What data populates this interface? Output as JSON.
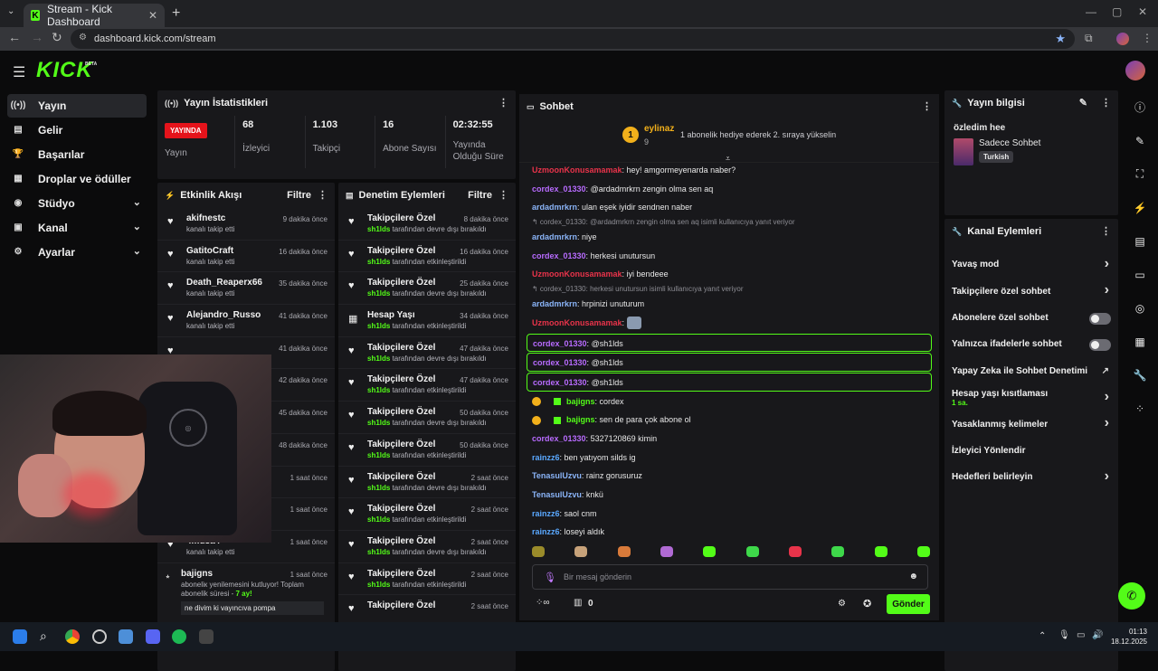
{
  "browser": {
    "tab_title": "Stream - Kick Dashboard",
    "url": "dashboard.kick.com/stream"
  },
  "app": {
    "logo": "KICK",
    "logo_tag": "BETA"
  },
  "sidebar": {
    "items": [
      {
        "label": "Yayın",
        "icon": "broadcast-icon"
      },
      {
        "label": "Gelir",
        "icon": "money-icon"
      },
      {
        "label": "Başarılar",
        "icon": "trophy-icon"
      },
      {
        "label": "Droplar ve ödüller",
        "icon": "gift-icon"
      },
      {
        "label": "Stüdyo",
        "icon": "camera-icon"
      },
      {
        "label": "Kanal",
        "icon": "channel-icon"
      },
      {
        "label": "Ayarlar",
        "icon": "gear-icon"
      }
    ]
  },
  "stats": {
    "title": "Yayın İstatistikleri",
    "live_label": "YAYINDA",
    "status_label": "Yayın",
    "viewers": "68",
    "viewers_label": "İzleyici",
    "followers": "1.103",
    "followers_label": "Takipçi",
    "subs": "16",
    "subs_label": "Abone Sayısı",
    "uptime": "02:32:55",
    "uptime_label": "Yayında Olduğu Süre"
  },
  "activity": {
    "title": "Etkinlik Akışı",
    "filter": "Filtre",
    "items": [
      {
        "name": "akifnestc",
        "sub": "kanalı takip etti",
        "time": "9 dakika önce"
      },
      {
        "name": "GatitoCraft",
        "sub": "kanalı takip etti",
        "time": "16 dakika önce"
      },
      {
        "name": "Death_Reaperx66",
        "sub": "kanalı takip etti",
        "time": "35 dakika önce"
      },
      {
        "name": "Alejandro_Russo",
        "sub": "kanalı takip etti",
        "time": "41 dakika önce"
      },
      {
        "name": "",
        "sub": "",
        "time": "41 dakika önce"
      },
      {
        "name": "",
        "sub": "",
        "time": "42 dakika önce"
      },
      {
        "name": "",
        "sub": "",
        "time": "45 dakika önce"
      },
      {
        "name": "",
        "sub": "",
        "time": "48 dakika önce"
      },
      {
        "name": "",
        "sub": "kanalı takip etti",
        "time": "1 saat önce"
      },
      {
        "name": "ivenborn055",
        "sub": "kanalı takip etti",
        "time": "1 saat önce"
      },
      {
        "name": "4musa4",
        "sub": "kanalı takip etti",
        "time": "1 saat önce"
      }
    ],
    "last": {
      "name": "bajigns",
      "time": "1 saat önce",
      "text": "aboneliк yenilemesini kutluyor! Toplam abonelik süresi -",
      "months": "7 ay!",
      "message": "ne divim ki vayıncıva pompa"
    }
  },
  "moderation": {
    "title": "Denetim Eylemleri",
    "filter": "Filtre",
    "items": [
      {
        "title": "Takipçilere Özel",
        "actor": "sh1lds",
        "action": "tarafından devre dışı bırakıldı",
        "time": "8 dakika önce"
      },
      {
        "title": "Takipçilere Özel",
        "actor": "sh1lds",
        "action": "tarafından etkinleştirildi",
        "time": "16 dakika önce"
      },
      {
        "title": "Takipçilere Özel",
        "actor": "sh1lds",
        "action": "tarafından devre dışı bırakıldı",
        "time": "25 dakika önce"
      },
      {
        "title": "Hesap Yaşı",
        "actor": "sh1lds",
        "action": "tarafından etkinleştirildi",
        "time": "34 dakika önce"
      },
      {
        "title": "Takipçilere Özel",
        "actor": "sh1lds",
        "action": "tarafından devre dışı bırakıldı",
        "time": "47 dakika önce"
      },
      {
        "title": "Takipçilere Özel",
        "actor": "sh1lds",
        "action": "tarafından etkinleştirildi",
        "time": "47 dakika önce"
      },
      {
        "title": "Takipçilere Özel",
        "actor": "sh1lds",
        "action": "tarafından devre dışı bırakıldı",
        "time": "50 dakika önce"
      },
      {
        "title": "Takipçilere Özel",
        "actor": "sh1lds",
        "action": "tarafından etkinleştirildi",
        "time": "50 dakika önce"
      },
      {
        "title": "Takipçilere Özel",
        "actor": "sh1lds",
        "action": "tarafından devre dışı bırakıldı",
        "time": "2 saat önce"
      },
      {
        "title": "Takipçilere Özel",
        "actor": "sh1lds",
        "action": "tarafından etkinleştirildi",
        "time": "2 saat önce"
      },
      {
        "title": "Takipçilere Özel",
        "actor": "sh1lds",
        "action": "tarafından devre dışı bırakıldı",
        "time": "2 saat önce"
      },
      {
        "title": "Takipçilere Özel",
        "actor": "sh1lds",
        "action": "tarafından etkinleştirildi",
        "time": "2 saat önce"
      },
      {
        "title": "Takipçilere Özel",
        "actor": "",
        "action": "",
        "time": "2 saat önce"
      }
    ]
  },
  "chat": {
    "title": "Sohbet",
    "pinned": {
      "rank": "1",
      "name": "eylinaz",
      "count": "9",
      "text": "1 abonelik hediye ederek 2. sıraya yükselin"
    },
    "messages": [
      {
        "user": "UzmoonKonusamamak",
        "color": "#e8334a",
        "text": "hey! amgormeyenarda naber?",
        "reply": "",
        "hl": false
      },
      {
        "user": "cordex_01330",
        "color": "#b86bff",
        "text": "@ardadmrkrn zengin olma sen aq",
        "reply": "",
        "hl": false
      },
      {
        "user": "ardadmrkrn",
        "color": "#8ab4f8",
        "text": "ulan eşek iyidir sendnen naber",
        "reply": "",
        "hl": false
      },
      {
        "user": "ardadmrkrn",
        "color": "#8ab4f8",
        "text": "niye",
        "reply": "↰ cordex_01330: @ardadmrkrn zengin olma sen aq isimli kullanıcıya yanıt veriyor",
        "hl": false
      },
      {
        "user": "cordex_01330",
        "color": "#b86bff",
        "text": "herkesi unutursun",
        "reply": "",
        "hl": false
      },
      {
        "user": "UzmoonKonusamamak",
        "color": "#e8334a",
        "text": "iyi bendeee",
        "reply": "",
        "hl": false
      },
      {
        "user": "ardadmrkrn",
        "color": "#8ab4f8",
        "text": "hrpinizi unuturum",
        "reply": "↰ cordex_01330: herkesi unutursun isimli kullanıcıya yanıt veriyor",
        "hl": false
      },
      {
        "user": "UzmoonKonusamamak",
        "color": "#e8334a",
        "text": "",
        "reply": "",
        "hl": false
      },
      {
        "user": "cordex_01330",
        "color": "#b86bff",
        "text": "@sh1lds",
        "reply": "",
        "hl": true
      },
      {
        "user": "cordex_01330",
        "color": "#b86bff",
        "text": "@sh1lds",
        "reply": "",
        "hl": true
      },
      {
        "user": "cordex_01330",
        "color": "#b86bff",
        "text": "@sh1lds",
        "reply": "",
        "hl": true
      },
      {
        "user": "bajigns",
        "color": "#53fc18",
        "text": "cordex",
        "reply": "",
        "hl": false
      },
      {
        "user": "bajigns",
        "color": "#53fc18",
        "text": "sen de para çok abone ol",
        "reply": "",
        "hl": false
      },
      {
        "user": "cordex_01330",
        "color": "#b86bff",
        "text": "5327120869 kimin",
        "reply": "",
        "hl": false
      },
      {
        "user": "rainzz6",
        "color": "#5aa8ff",
        "text": "ben yatıyom silds ig",
        "reply": "",
        "hl": false
      },
      {
        "user": "TenasulUzvu",
        "color": "#8ab4f8",
        "text": "rainz gorusuruz",
        "reply": "",
        "hl": false
      },
      {
        "user": "TenasulUzvu",
        "color": "#8ab4f8",
        "text": "knkü",
        "reply": "",
        "hl": false
      },
      {
        "user": "rainzz6",
        "color": "#5aa8ff",
        "text": "saol cnm",
        "reply": "",
        "hl": false
      },
      {
        "user": "rainzz6",
        "color": "#5aa8ff",
        "text": "loseyi aldık",
        "reply": "",
        "hl": false
      }
    ],
    "input_placeholder": "Bir mesaj gönderin",
    "points": "0",
    "send_label": "Gönder"
  },
  "stream_info": {
    "title": "Yayın bilgisi",
    "stream_title": "özledim hee",
    "category": "Sadece Sohbet",
    "language": "Turkish"
  },
  "channel_actions": {
    "title": "Kanal Eylemleri",
    "items": [
      {
        "label": "Yavaş mod",
        "type": "chevron"
      },
      {
        "label": "Takipçilere özel sohbet",
        "type": "chevron"
      },
      {
        "label": "Abonelere özel sohbet",
        "type": "toggle"
      },
      {
        "label": "Yalnızca ifadelerle sohbet",
        "type": "toggle"
      },
      {
        "label": "Yapay Zeka ile Sohbet Denetimi",
        "type": "external"
      },
      {
        "label": "Hesap yaşı kısıtlaması",
        "sub": "1 sa.",
        "type": "chevron"
      },
      {
        "label": "Yasaklanmış kelimeler",
        "type": "chevron"
      },
      {
        "label": "İzleyici Yönlendir",
        "type": "none"
      },
      {
        "label": "Hedefleri belirleyin",
        "type": "chevron"
      }
    ]
  },
  "taskbar": {
    "time": "01:13",
    "date": "18.12.2025"
  },
  "colors": {
    "accent": "#53fc18",
    "live": "#e5131b",
    "panel": "#18181b"
  }
}
